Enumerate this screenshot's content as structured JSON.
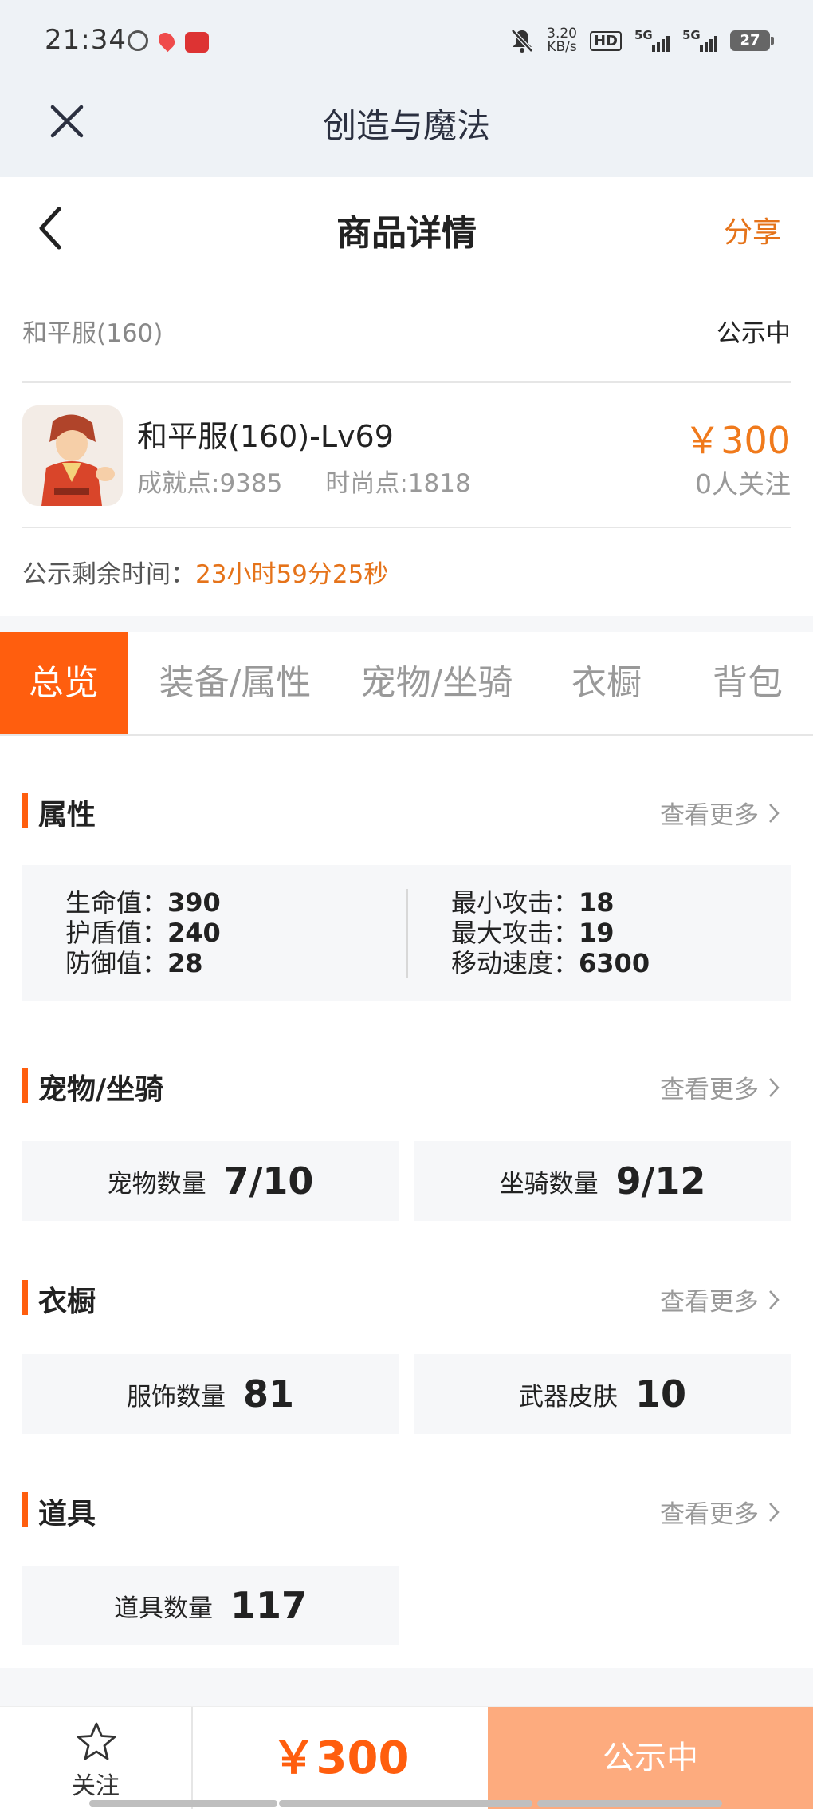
{
  "status_bar": {
    "time": "21:34",
    "net_speed_value": "3.20",
    "net_speed_unit": "KB/s",
    "hd": "HD",
    "signal1": "5G",
    "signal2": "5G",
    "battery": "27"
  },
  "app_bar": {
    "title": "创造与魔法",
    "close_icon": "close-icon"
  },
  "header": {
    "title": "商品详情",
    "share_label": "分享",
    "back_icon": "chevron-left-icon"
  },
  "server": {
    "name": "和平服(160)",
    "status": "公示中"
  },
  "product": {
    "name": "和平服(160)-Lv69",
    "achievement": "成就点:9385",
    "fashion": "时尚点:1818",
    "price": "￥300",
    "followers": "0人关注"
  },
  "countdown": {
    "label": "公示剩余时间：",
    "value": "23小时59分25秒"
  },
  "tabs": [
    {
      "label": "总览",
      "active": true
    },
    {
      "label": "装备/属性",
      "active": false
    },
    {
      "label": "宠物/坐骑",
      "active": false
    },
    {
      "label": "衣橱",
      "active": false
    },
    {
      "label": "背包",
      "active": false
    }
  ],
  "sections": {
    "attributes": {
      "title": "属性",
      "more": "查看更多",
      "left": [
        {
          "label": "生命值：",
          "value": "390"
        },
        {
          "label": "护盾值：",
          "value": "240"
        },
        {
          "label": "防御值：",
          "value": "28"
        }
      ],
      "right": [
        {
          "label": "最小攻击：",
          "value": "18"
        },
        {
          "label": "最大攻击：",
          "value": "19"
        },
        {
          "label": "移动速度：",
          "value": "6300"
        }
      ]
    },
    "pets": {
      "title": "宠物/坐骑",
      "more": "查看更多",
      "cards": [
        {
          "label": "宠物数量",
          "value": "7/10"
        },
        {
          "label": "坐骑数量",
          "value": "9/12"
        }
      ]
    },
    "wardrobe": {
      "title": "衣橱",
      "more": "查看更多",
      "cards": [
        {
          "label": "服饰数量",
          "value": "81"
        },
        {
          "label": "武器皮肤",
          "value": "10"
        }
      ]
    },
    "items": {
      "title": "道具",
      "more": "查看更多",
      "cards": [
        {
          "label": "道具数量",
          "value": "117"
        }
      ]
    }
  },
  "bottom_bar": {
    "follow_label": "关注",
    "price": "￥300",
    "action_label": "公示中"
  },
  "colors": {
    "accent": "#ff5e0e",
    "price": "#f07a1c",
    "action_button": "#fdab7e"
  }
}
